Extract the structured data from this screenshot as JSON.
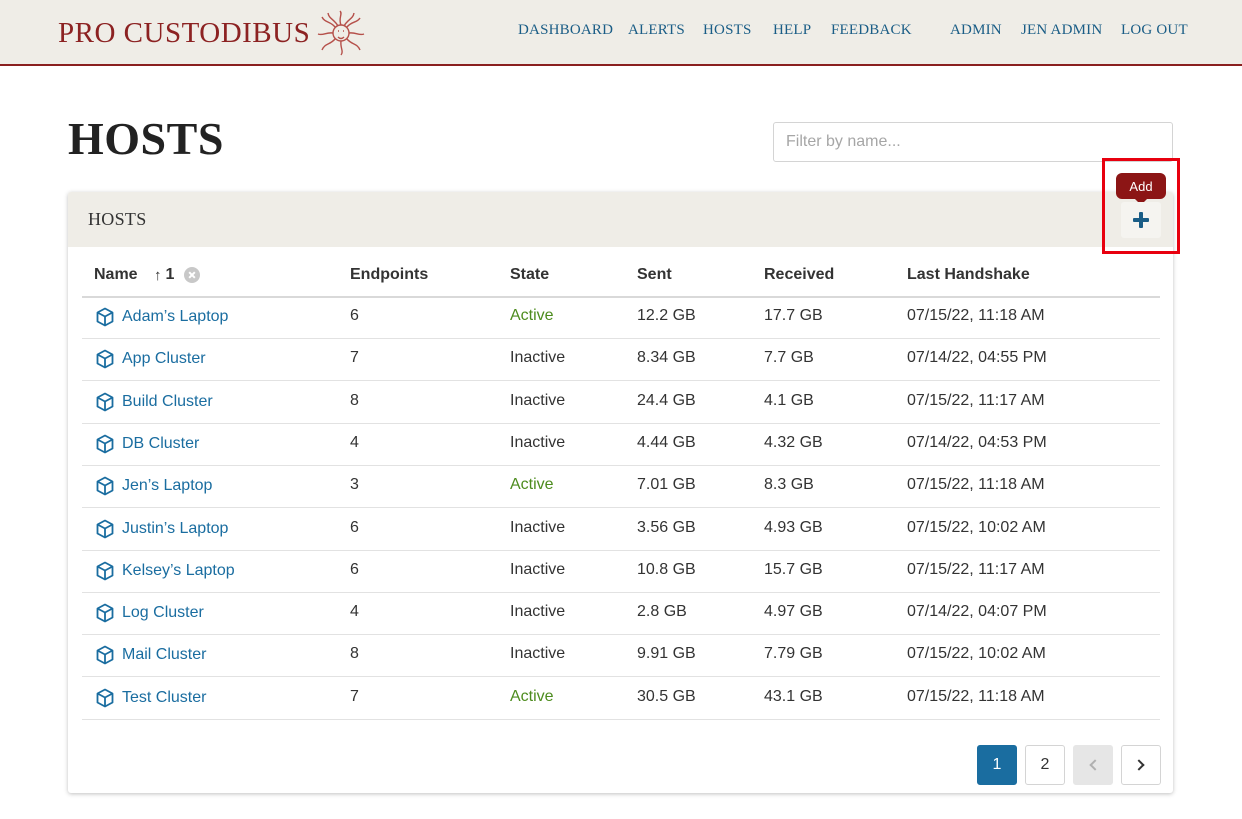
{
  "nav": {
    "brand": "PRO CUSTODIBUS",
    "links": [
      {
        "label": "DASHBOARD"
      },
      {
        "label": "ALERTS"
      },
      {
        "label": "HOSTS"
      },
      {
        "label": "HELP"
      },
      {
        "label": "FEEDBACK"
      },
      {
        "label": "ADMIN"
      },
      {
        "label": "JEN ADMIN"
      },
      {
        "label": "LOG OUT"
      }
    ]
  },
  "page": {
    "title": "HOSTS",
    "filter_placeholder": "Filter by name..."
  },
  "card": {
    "title": "HOSTS",
    "add_tooltip": "Add"
  },
  "table": {
    "columns": {
      "name": "Name",
      "endpoints": "Endpoints",
      "state": "State",
      "sent": "Sent",
      "received": "Received",
      "last_handshake": "Last Handshake"
    },
    "sort": {
      "arrow": "↑",
      "order": "1"
    },
    "rows": [
      {
        "name": "Adam’s Laptop",
        "endpoints": "6",
        "state": "Active",
        "sent": "12.2 GB",
        "received": "17.7 GB",
        "last_handshake": "07/15/22, 11:18 AM"
      },
      {
        "name": "App Cluster",
        "endpoints": "7",
        "state": "Inactive",
        "sent": "8.34 GB",
        "received": "7.7 GB",
        "last_handshake": "07/14/22, 04:55 PM"
      },
      {
        "name": "Build Cluster",
        "endpoints": "8",
        "state": "Inactive",
        "sent": "24.4 GB",
        "received": "4.1 GB",
        "last_handshake": "07/15/22, 11:17 AM"
      },
      {
        "name": "DB Cluster",
        "endpoints": "4",
        "state": "Inactive",
        "sent": "4.44 GB",
        "received": "4.32 GB",
        "last_handshake": "07/14/22, 04:53 PM"
      },
      {
        "name": "Jen’s Laptop",
        "endpoints": "3",
        "state": "Active",
        "sent": "7.01 GB",
        "received": "8.3 GB",
        "last_handshake": "07/15/22, 11:18 AM"
      },
      {
        "name": "Justin’s Laptop",
        "endpoints": "6",
        "state": "Inactive",
        "sent": "3.56 GB",
        "received": "4.93 GB",
        "last_handshake": "07/15/22, 10:02 AM"
      },
      {
        "name": "Kelsey’s Laptop",
        "endpoints": "6",
        "state": "Inactive",
        "sent": "10.8 GB",
        "received": "15.7 GB",
        "last_handshake": "07/15/22, 11:17 AM"
      },
      {
        "name": "Log Cluster",
        "endpoints": "4",
        "state": "Inactive",
        "sent": "2.8 GB",
        "received": "4.97 GB",
        "last_handshake": "07/14/22, 04:07 PM"
      },
      {
        "name": "Mail Cluster",
        "endpoints": "8",
        "state": "Inactive",
        "sent": "9.91 GB",
        "received": "7.79 GB",
        "last_handshake": "07/15/22, 10:02 AM"
      },
      {
        "name": "Test Cluster",
        "endpoints": "7",
        "state": "Active",
        "sent": "30.5 GB",
        "received": "43.1 GB",
        "last_handshake": "07/15/22, 11:18 AM"
      }
    ]
  },
  "pagination": {
    "pages": [
      "1",
      "2"
    ],
    "current": "1"
  },
  "colors": {
    "brand": "#8c2222",
    "link": "#1a6da0",
    "active_state": "#4d8c1e",
    "highlight": "#e8000f"
  }
}
